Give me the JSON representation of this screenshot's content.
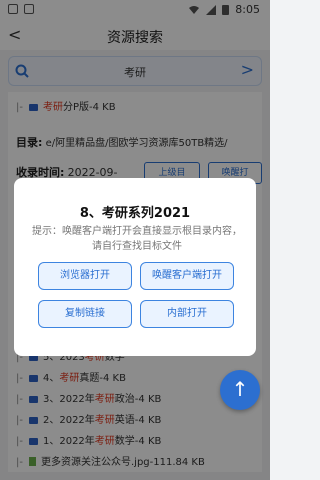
{
  "status": {
    "time": "8:05"
  },
  "header": {
    "title": "资源搜索",
    "back": "<"
  },
  "search": {
    "query": "考研",
    "chevron": ">"
  },
  "result": {
    "top_row": {
      "dash": "|-",
      "pre": "",
      "highlight": "考研",
      "post": "分P版-4 KB"
    },
    "path_label": "目录:",
    "path_value": "e/阿里精品盘/图欧学习资源库50TB精选/",
    "time_label": "收录时间:",
    "time_value": "2022-09-",
    "btn_parent": "上级目",
    "btn_wake": "唤醒打"
  },
  "list": [
    {
      "dash": "|-",
      "pre": "5、2023",
      "highlight": "考研",
      "post": "数学"
    },
    {
      "dash": "|-",
      "pre": "4、",
      "highlight": "考研",
      "post": "真题-4 KB"
    },
    {
      "dash": "|-",
      "pre": "3、2022年",
      "highlight": "考研",
      "post": "政治-4 KB"
    },
    {
      "dash": "|-",
      "pre": "2、2022年",
      "highlight": "考研",
      "post": "英语-4 KB"
    },
    {
      "dash": "|-",
      "pre": "1、2022年",
      "highlight": "考研",
      "post": "数学-4 KB"
    },
    {
      "dash": "|-",
      "pre": "更多资源关注公众号.jpg-111.84 KB",
      "highlight": "",
      "post": ""
    }
  ],
  "dialog": {
    "title": "8、考研系列2021",
    "message": "提示：唤醒客户端打开会直接显示根目录内容，请自行查找目标文件",
    "btn_browser": "浏览器打开",
    "btn_client": "唤醒客户端打开",
    "btn_copy": "复制链接",
    "btn_internal": "内部打开"
  },
  "fab_icon": "↑"
}
